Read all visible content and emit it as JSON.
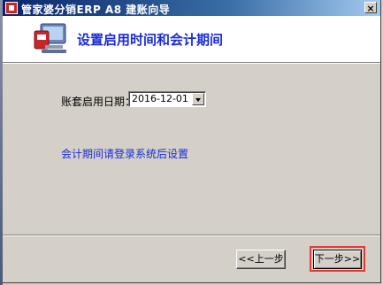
{
  "window": {
    "title": "管家婆分销ERP A8 建账向导",
    "close_label": "×",
    "icon": "app-logo-icon"
  },
  "header": {
    "title": "设置启用时间和会计期间",
    "icon": "computer-wizard-icon"
  },
  "form": {
    "date_label": "账套启用日期：",
    "date_value": "2016-12-01"
  },
  "note": {
    "text": "会计期间请登录系统后设置"
  },
  "buttons": {
    "prev_label": "<<上一步",
    "next_label": "下一步>>"
  },
  "colors": {
    "accent_text": "#1a2bd6",
    "highlight": "#e53935",
    "titlebar": "#0a246a"
  }
}
